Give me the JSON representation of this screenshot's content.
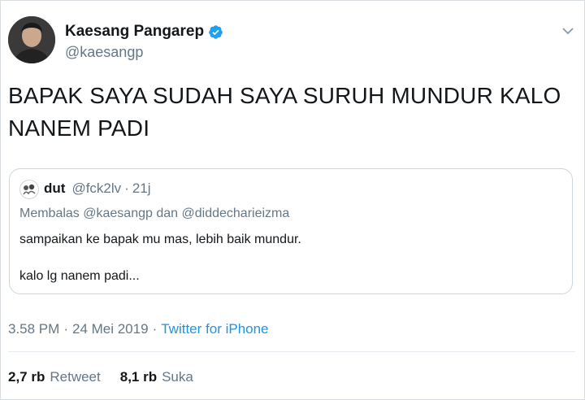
{
  "author": {
    "name": "Kaesang Pangarep",
    "handle": "@kaesangp",
    "verified": true
  },
  "tweet": {
    "text": "BAPAK SAYA SUDAH SAYA SURUH MUNDUR KALO NANEM PADI"
  },
  "quoted": {
    "name": "dut",
    "handle": "@fck2lv",
    "separator": "·",
    "time": "21j",
    "reply_prefix": "Membalas",
    "reply_mention1": "@kaesangp",
    "reply_joiner": "dan",
    "reply_mention2": "@diddecharieizma",
    "line1": "sampaikan ke bapak mu mas, lebih baik mundur.",
    "line2": "kalo lg nanem padi..."
  },
  "meta": {
    "time": "3.58 PM",
    "separator": "·",
    "date": "24 Mei 2019",
    "source": "Twitter for iPhone"
  },
  "stats": {
    "retweets_count": "2,7 rb",
    "retweets_label": "Retweet",
    "likes_count": "8,1 rb",
    "likes_label": "Suka"
  },
  "colors": {
    "link": "#1b95e0",
    "secondary_text": "#657786",
    "verified": "#1da1f2"
  },
  "icons": [
    "verified-badge-icon",
    "chevron-down-icon"
  ]
}
